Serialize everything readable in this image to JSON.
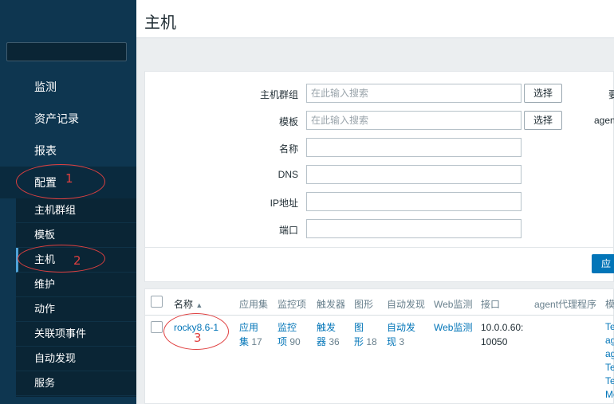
{
  "header": {
    "title": "主机"
  },
  "sidebar": {
    "items": [
      {
        "label": "监测"
      },
      {
        "label": "资产记录"
      },
      {
        "label": "报表"
      },
      {
        "label": "配置"
      }
    ],
    "submenu": [
      {
        "label": "主机群组"
      },
      {
        "label": "模板"
      },
      {
        "label": "主机"
      },
      {
        "label": "维护"
      },
      {
        "label": "动作"
      },
      {
        "label": "关联项事件"
      },
      {
        "label": "自动发现"
      },
      {
        "label": "服务"
      }
    ]
  },
  "filter": {
    "host_group_label": "主机群组",
    "host_group_placeholder": "在此输入搜索",
    "template_label": "模板",
    "template_placeholder": "在此输入搜索",
    "select_label": "选择",
    "name_label": "名称",
    "dns_label": "DNS",
    "ip_label": "IP地址",
    "port_label": "端口",
    "apply_label": "应",
    "right_fragment_1": "要",
    "right_fragment_2": "agen"
  },
  "table": {
    "headers": {
      "name": "名称",
      "sort_arrow": "▲",
      "applications": "应用集",
      "items": "监控项",
      "triggers": "触发器",
      "graphs": "图形",
      "discovery": "自动发现",
      "web": "Web监测",
      "interface": "接口",
      "proxy": "agent代理程序",
      "templates": "模"
    },
    "rows": [
      {
        "name": "rocky8.6-1",
        "applications_1": "应用",
        "applications_2": "集",
        "applications_count": "17",
        "items_1": "监控",
        "items_2": "项",
        "items_count": "90",
        "triggers_1": "触发",
        "triggers_2": "器",
        "triggers_count": "36",
        "graphs_1": "图",
        "graphs_2": "形",
        "graphs_count": "18",
        "discovery_1": "自动发",
        "discovery_2": "现",
        "discovery_count": "3",
        "web": "Web监测",
        "interface_1": "10.0.0.60:",
        "interface_2": "10050",
        "templates": [
          "Te",
          "ag",
          "ag",
          "Te",
          "Te",
          "Mo"
        ]
      }
    ]
  },
  "annotations": [
    "1",
    "2",
    "3"
  ],
  "colors": {
    "sidebar": "#0e3650",
    "link": "#0275b8",
    "annotation": "#e04040"
  }
}
